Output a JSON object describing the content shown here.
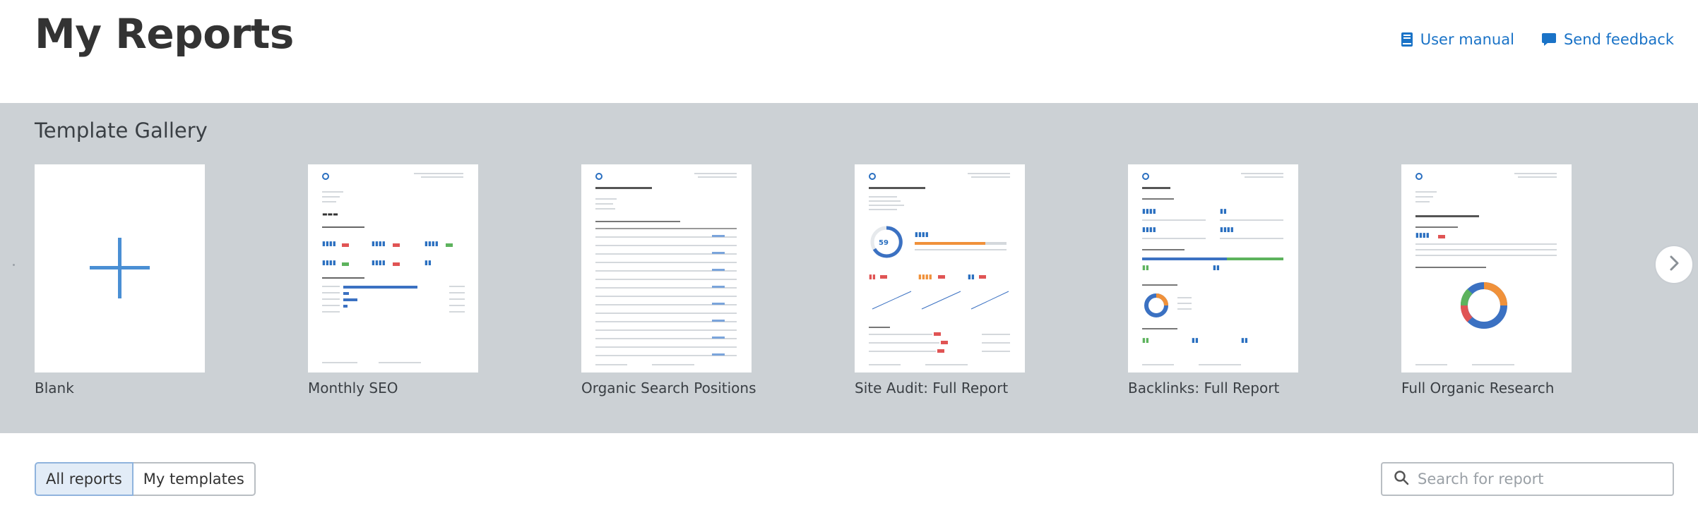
{
  "header": {
    "title": "My Reports",
    "user_manual": "User manual",
    "send_feedback": "Send feedback",
    "link_color": "#1a73c7"
  },
  "gallery": {
    "title": "Template Gallery",
    "background": "#ccd1d5",
    "next_icon": "chevron-right-icon",
    "templates": [
      {
        "label": "Blank",
        "icon": "plus-icon"
      },
      {
        "label": "Monthly SEO"
      },
      {
        "label": "Organic Search Positions"
      },
      {
        "label": "Site Audit: Full Report"
      },
      {
        "label": "Backlinks: Full Report"
      },
      {
        "label": "Full Organic Research"
      }
    ]
  },
  "filters": {
    "tabs": [
      {
        "label": "All reports",
        "active": true
      },
      {
        "label": "My templates",
        "active": false
      }
    ]
  },
  "search": {
    "placeholder": "Search for report",
    "value": ""
  }
}
